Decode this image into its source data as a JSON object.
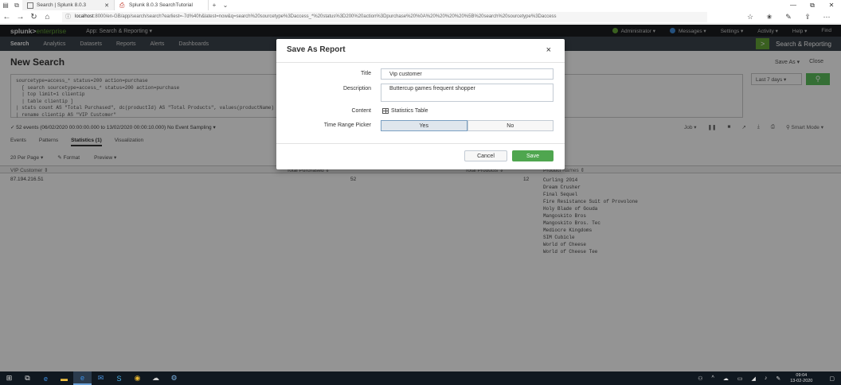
{
  "browser": {
    "tabs": [
      {
        "title": "Search | Splunk 8.0.3",
        "active": true
      },
      {
        "title": "Splunk 8.0.3 SearchTutorial",
        "active": false
      }
    ],
    "url_host": "localhost",
    "url_rest": ":8000/en-GB/app/search/search?earliest=-7d%40h&latest=now&q=search%20sourcetype%3Daccess_*%20status%3D200%20action%3Dpurchase%20%0A%20%20%20%20%5B%20search%20sourcetype%3Daccess"
  },
  "splunk": {
    "logo_main": "splunk>",
    "logo_sub": "enterprise",
    "app_label": "App: Search & Reporting ▾",
    "top_menu": [
      "Administrator ▾",
      "Messages ▾",
      "Settings ▾",
      "Activity ▾",
      "Help ▾",
      "Find"
    ],
    "nav": [
      "Search",
      "Analytics",
      "Datasets",
      "Reports",
      "Alerts",
      "Dashboards"
    ],
    "app_title": "Search & Reporting",
    "page_title": "New Search",
    "page_actions": [
      "Save As ▾",
      "Close"
    ],
    "search_lines": [
      "sourcetype=access_* status=200 action=purchase",
      "  [ search sourcetype=access_* status=200 action=purchase",
      "  | top limit=1 clientip",
      "  | table clientip ]",
      "| stats count AS \"Total Purchased\", dc(productId) AS \"Total Products\", values(productName) AS \"Product Names\" BY clientip",
      "| rename clientip AS \"VIP Customer\""
    ],
    "time_picker": "Last 7 days ▾",
    "event_info": "✓ 52 events (06/02/2020 00:00:00.000 to 13/02/2020 00:00:10.000)   No Event Sampling ▾",
    "event_right": [
      "Job ▾",
      "❚❚",
      "■",
      "↗",
      "⤓",
      "⎙",
      "⚲ Smart Mode ▾"
    ],
    "sub_tabs": [
      "Events",
      "Patterns",
      "Statistics (1)",
      "Visualization"
    ],
    "options": [
      "20 Per Page ▾",
      "✎ Format",
      "Preview ▾"
    ],
    "columns": [
      "VIP Customer ⇕",
      "Total Purchased ⇕",
      "Total Products ⇕",
      "Product Names ⇕"
    ],
    "row": {
      "customer": "87.194.216.51",
      "purchased": "52",
      "products": "12"
    },
    "product_names": [
      "Curling 2014",
      "Dream Crusher",
      "Final Sequel",
      "Fire Resistance Suit of Provolone",
      "Holy Blade of Gouda",
      "Mangoskito Bros",
      "Mangoskito Bros. Tec",
      "Mediocre Kingdoms",
      "SIM Cubicle",
      "World of Cheese",
      "World of Cheese Tee"
    ]
  },
  "modal": {
    "title": "Save As Report",
    "close": "×",
    "title_label": "Title",
    "title_value": "Vip customer",
    "description_label": "Description",
    "description_value": "Buttercup games frequent shopper",
    "content_label": "Content",
    "content_value": "Statistics Table",
    "time_range_label": "Time Range Picker",
    "time_range_options": [
      "Yes",
      "No"
    ],
    "time_range_selected": "Yes",
    "cancel": "Cancel",
    "save": "Save"
  },
  "taskbar": {
    "clock_time": "09:04",
    "clock_date": "13-02-2020"
  },
  "colors": {
    "save_button": "#4fa64f",
    "splunk_green": "#65a637",
    "topnav": "#1a1c20",
    "appbar": "#3c444d"
  }
}
